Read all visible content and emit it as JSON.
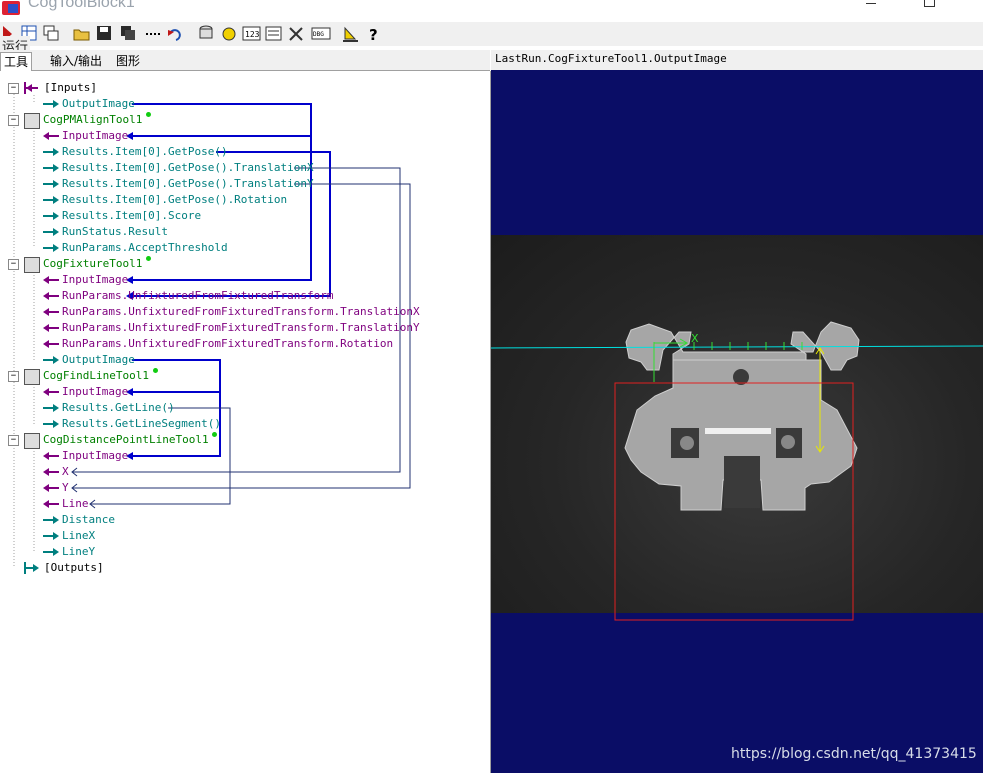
{
  "window": {
    "title": "CogToolBlock1"
  },
  "toolbar": {
    "run_label": "运行",
    "icons": [
      "run-icon",
      "grid-icon",
      "copy-window-icon",
      "open-folder-icon",
      "save-icon",
      "save-all-icon",
      "dotted-line-icon",
      "reset-icon",
      "database-icon",
      "refresh-icon",
      "numeric-123-icon",
      "list-icon",
      "tools-icon",
      "dbg-icon",
      "ruler-icon",
      "help-icon"
    ]
  },
  "tabs": [
    "工具",
    "输入/输出",
    "图形"
  ],
  "tree": {
    "nodes": [
      {
        "label": "[Inputs]",
        "kind": "section"
      },
      {
        "label": "OutputImage",
        "kind": "output"
      },
      {
        "label": "CogPMAlignTool1",
        "kind": "tool"
      },
      {
        "label": "InputImage",
        "kind": "input"
      },
      {
        "label": "Results.Item[0].GetPose()",
        "kind": "output"
      },
      {
        "label": "Results.Item[0].GetPose().TranslationX",
        "kind": "output"
      },
      {
        "label": "Results.Item[0].GetPose().TranslationY",
        "kind": "output"
      },
      {
        "label": "Results.Item[0].GetPose().Rotation",
        "kind": "output"
      },
      {
        "label": "Results.Item[0].Score",
        "kind": "output"
      },
      {
        "label": "RunStatus.Result",
        "kind": "output"
      },
      {
        "label": "RunParams.AcceptThreshold",
        "kind": "output"
      },
      {
        "label": "CogFixtureTool1",
        "kind": "tool"
      },
      {
        "label": "InputImage",
        "kind": "input"
      },
      {
        "label": "RunParams.UnfixturedFromFixturedTransform",
        "kind": "input"
      },
      {
        "label": "RunParams.UnfixturedFromFixturedTransform.TranslationX",
        "kind": "input"
      },
      {
        "label": "RunParams.UnfixturedFromFixturedTransform.TranslationY",
        "kind": "input"
      },
      {
        "label": "RunParams.UnfixturedFromFixturedTransform.Rotation",
        "kind": "input"
      },
      {
        "label": "OutputImage",
        "kind": "output"
      },
      {
        "label": "CogFindLineTool1",
        "kind": "tool"
      },
      {
        "label": "InputImage",
        "kind": "input"
      },
      {
        "label": "Results.GetLine()",
        "kind": "output"
      },
      {
        "label": "Results.GetLineSegment()",
        "kind": "output"
      },
      {
        "label": "CogDistancePointLineTool1",
        "kind": "tool"
      },
      {
        "label": "InputImage",
        "kind": "input"
      },
      {
        "label": "X",
        "kind": "input"
      },
      {
        "label": "Y",
        "kind": "input"
      },
      {
        "label": "Line",
        "kind": "input"
      },
      {
        "label": "Distance",
        "kind": "output"
      },
      {
        "label": "LineX",
        "kind": "output"
      },
      {
        "label": "LineY",
        "kind": "output"
      },
      {
        "label": "[Outputs]",
        "kind": "section"
      }
    ]
  },
  "display": {
    "caption": "LastRun.CogFixtureTool1.OutputImage",
    "x_marker": "X"
  },
  "watermark": "https://blog.csdn.net/qq_41373415",
  "colors": {
    "output_arrow": "#007f7f",
    "input_arrow": "#7f007f",
    "tool_label": "#008000",
    "link_line": "#0000cc",
    "display_background": "#0a0d66",
    "region_box": "#e02020",
    "found_line": "#00e0e0",
    "caliper": "#33dd33",
    "distance": "#e8e800"
  }
}
